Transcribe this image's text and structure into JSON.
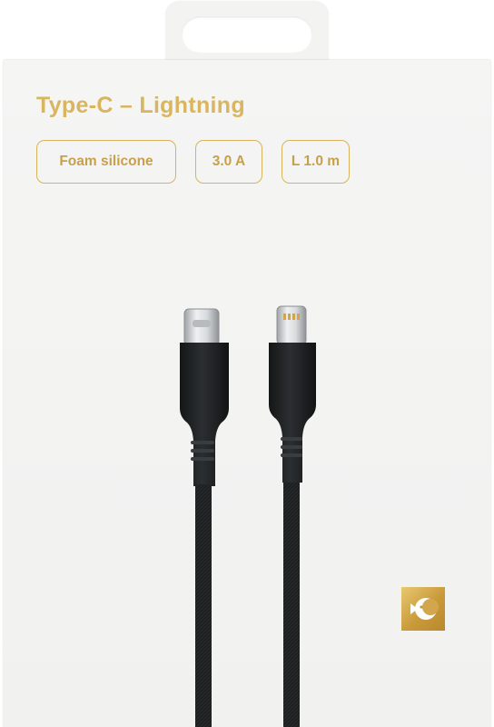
{
  "package": {
    "title": "Type-C – Lightning",
    "features": [
      "Foam silicone",
      "3.0 A",
      "L 1.0 m"
    ]
  },
  "product": {
    "connector_left": "USB Type-C",
    "connector_right": "Lightning",
    "cable_color": "#1d2021"
  },
  "brand": {
    "logo_icon": "fish-logo-icon",
    "accent_color": "#d7b35d"
  }
}
